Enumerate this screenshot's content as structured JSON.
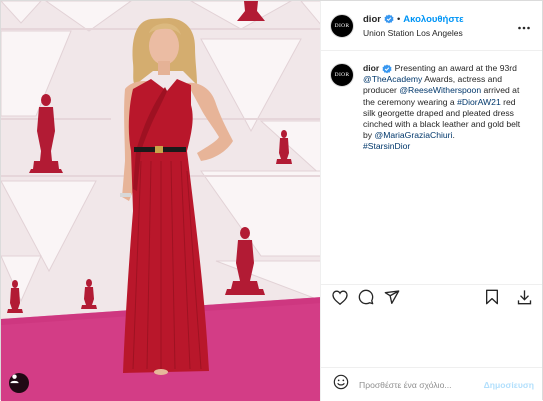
{
  "post": {
    "username": "dior",
    "avatar_text": "DIOR",
    "separator": "•",
    "follow_label": "Ακολουθήστε",
    "location": "Union Station Los Angeles",
    "more_icon": "more-horizontal-icon",
    "verified_icon": "verified-badge-icon",
    "caption": {
      "p1": "Presenting an award at the 93rd ",
      "m1": "@TheAcademy",
      "p2": " Awards, actress and producer ",
      "m2": "@ReeseWitherspoon",
      "p3": " arrived at the ceremony wearing a ",
      "h1": "#DiorAW21",
      "p4": " red silk georgette draped and pleated dress cinched with a black leather and gold belt by ",
      "m3": "@MariaGraziaChiuri",
      "p5": ".",
      "h2": "#StarsinDior"
    }
  },
  "actions": {
    "like_icon": "heart-icon",
    "comment_icon": "comment-icon",
    "share_icon": "share-icon",
    "save_icon": "bookmark-icon"
  },
  "comment_box": {
    "emoji_icon": "emoji-icon",
    "placeholder": "Προσθέστε ένα σχόλιο...",
    "post_label": "Δημοσίευση"
  },
  "photo": {
    "user_tag_icon": "user-tag-icon",
    "colors": {
      "wall": "#f0e6e8",
      "carpet": "#d23c84",
      "dress": "#b8182a",
      "statue": "#b01a32",
      "skin": "#e8b39a",
      "hair": "#d9b57a"
    }
  },
  "colors": {
    "accent": "#0095f6",
    "link": "#00376b",
    "text": "#262626",
    "muted": "#8e8e8e",
    "border": "#dbdbdb"
  }
}
